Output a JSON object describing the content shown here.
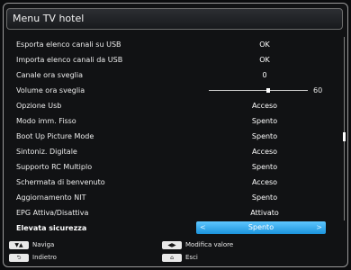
{
  "header": {
    "title": "Menu TV hotel"
  },
  "rows": [
    {
      "label": "Esporta elenco canali su USB",
      "value": "OK"
    },
    {
      "label": "Importa elenco canali da USB",
      "value": "OK"
    },
    {
      "label": "Canale ora sveglia",
      "value": "0"
    },
    {
      "label": "Volume ora sveglia",
      "value": "60",
      "slider_fraction": 0.6
    },
    {
      "label": "Opzione Usb",
      "value": "Acceso"
    },
    {
      "label": "Modo imm. Fisso",
      "value": "Spento"
    },
    {
      "label": "Boot Up Picture Mode",
      "value": "Spento"
    },
    {
      "label": "Sintoniz. Digitale",
      "value": "Acceso"
    },
    {
      "label": "Supporto RC Multiplo",
      "value": "Spento"
    },
    {
      "label": "Schermata di benvenuto",
      "value": "Acceso"
    },
    {
      "label": "Aggiornamento NIT",
      "value": "Spento"
    },
    {
      "label": "EPG Attiva/Disattiva",
      "value": "Attivato"
    },
    {
      "label": "Elevata sicurezza",
      "value": "Spento",
      "selected": true
    }
  ],
  "footer": {
    "navigate": "Naviga",
    "back": "Indietro",
    "modify": "Modifica valore",
    "exit": "Esci"
  },
  "icons": {
    "nav": "up-down-arrows-icon",
    "back": "return-arrow-icon",
    "modify": "left-right-arrows-icon",
    "exit": "home-icon"
  },
  "colors": {
    "selection": "#2aa6ee",
    "background": "#111214"
  }
}
